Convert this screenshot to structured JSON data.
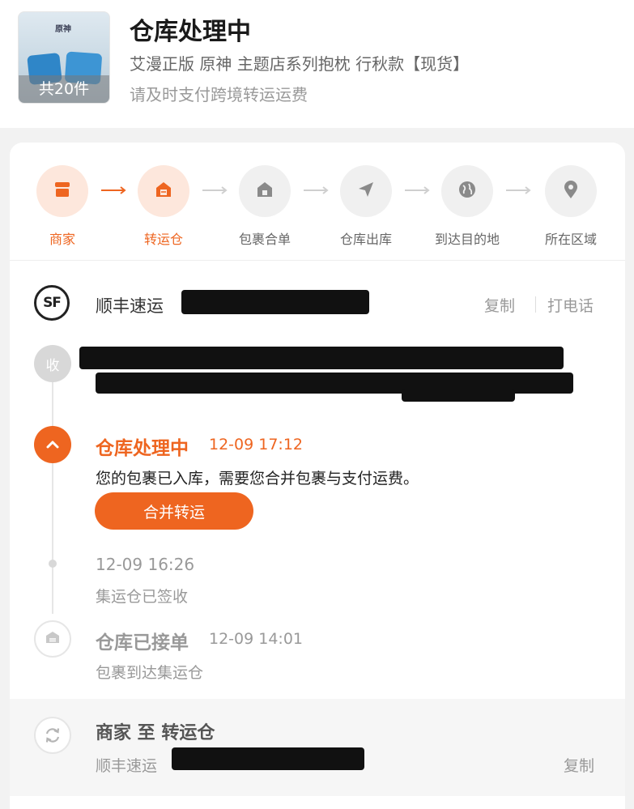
{
  "header": {
    "title": "仓库处理中",
    "product_name": "艾漫正版 原神 主题店系列抱枕 行秋款【现货】",
    "hint": "请及时支付跨境转运运费",
    "thumbnail_count": "共20件",
    "thumbnail_logo": "原神"
  },
  "steps": [
    {
      "label": "商家",
      "icon": "shop-icon",
      "active": true
    },
    {
      "label": "转运仓",
      "icon": "warehouse-icon",
      "active": true
    },
    {
      "label": "包裹合单",
      "icon": "package-merge-icon",
      "active": false
    },
    {
      "label": "仓库出库",
      "icon": "send-icon",
      "active": false
    },
    {
      "label": "到达目的地",
      "icon": "globe-icon",
      "active": false
    },
    {
      "label": "所在区域",
      "icon": "location-pin-icon",
      "active": false
    }
  ],
  "courier": {
    "logo_text": "SF",
    "name": "顺丰速运",
    "copy_label": "复制",
    "call_label": "打电话"
  },
  "receiver": {
    "badge": "收"
  },
  "timeline": [
    {
      "status": "仓库处理中",
      "time": "12-09 17:12",
      "desc": "您的包裹已入库，需要您合并包裹与支付运费。",
      "button": "合并转运"
    },
    {
      "time": "12-09 16:26",
      "desc": "集运仓已签收"
    },
    {
      "status": "仓库已接单",
      "time": "12-09 14:01",
      "desc": "包裹到达集运仓"
    }
  ],
  "segment": {
    "title": "商家 至 转运仓",
    "courier_name": "顺丰速运",
    "copy_label": "复制"
  },
  "colors": {
    "accent": "#ee6520",
    "accent_light": "#fde7dc",
    "muted": "#999999"
  }
}
